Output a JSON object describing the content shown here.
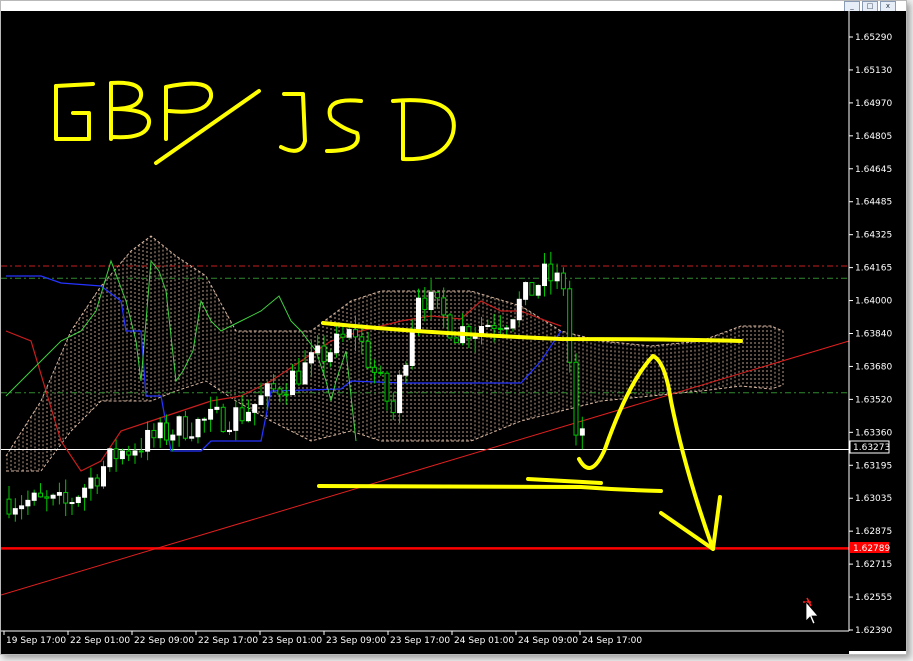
{
  "window": {
    "minimize_label": "_",
    "restore_label": "□",
    "close_label": "x"
  },
  "annotation": {
    "title": "GBP/USD",
    "color": "#ffff00"
  },
  "price_axis": {
    "labels": [
      "1.65290",
      "1.65130",
      "1.64970",
      "1.64805",
      "1.64645",
      "1.64485",
      "1.64325",
      "1.64165",
      "1.64000",
      "1.63840",
      "1.63680",
      "1.63520",
      "1.63360",
      "1.63195",
      "1.63035",
      "1.62875",
      "1.62715",
      "1.62555",
      "1.62390"
    ],
    "current_price": "1.63273",
    "current_price_color": "#ffffff",
    "line_price": "1.62789",
    "line_price_color": "#ff0000"
  },
  "time_axis": {
    "labels": [
      "19 Sep 17:00",
      "22 Sep 01:00",
      "22 Sep 09:00",
      "22 Sep 17:00",
      "23 Sep 01:00",
      "23 Sep 09:00",
      "23 Sep 17:00",
      "24 Sep 01:00",
      "24 Sep 09:00",
      "24 Sep 17:00"
    ]
  },
  "colors": {
    "background": "#000000",
    "bull_candle": "#ffffff",
    "bear_candle": "#00c800",
    "wick": "#00c800",
    "cloud": "#d8b6a0",
    "kijun": "#2433ff",
    "tenkan": "#c81e1e",
    "chikou": "#3fd13f",
    "trendline": "#e02020",
    "support": "#ff0000",
    "level_red": "#c81e1e",
    "level_green": "#2f8a2f"
  },
  "chart_data": {
    "type": "candlestick",
    "symbol": "GBP/USD",
    "ylim": [
      1.6239,
      1.6533
    ],
    "x": [
      "19 Sep 17:00",
      "22 Sep 01:00",
      "22 Sep 09:00",
      "22 Sep 17:00",
      "23 Sep 01:00",
      "23 Sep 09:00",
      "23 Sep 17:00",
      "24 Sep 01:00",
      "24 Sep 09:00",
      "24 Sep 17:00"
    ],
    "close": [
      1.6305,
      1.6322,
      1.6331,
      1.6352,
      1.6372,
      1.6349,
      1.6391,
      1.6404,
      1.6395,
      1.6327
    ],
    "horizontal_lines": [
      {
        "price": 1.6417,
        "style": "dash-dot",
        "color": "#c81e1e"
      },
      {
        "price": 1.6411,
        "style": "dash-dot",
        "color": "#2f8a2f"
      },
      {
        "price": 1.6355,
        "style": "dash-dot",
        "color": "#2f8a2f"
      },
      {
        "price": 1.63273,
        "style": "solid",
        "color": "#ffffff"
      },
      {
        "price": 1.62789,
        "style": "solid",
        "color": "#ff0000"
      }
    ]
  }
}
